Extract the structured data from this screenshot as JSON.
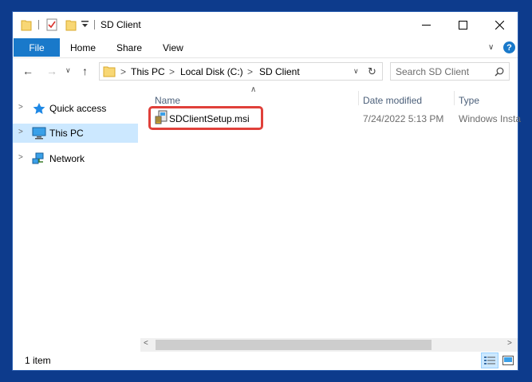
{
  "window": {
    "title": "SD Client"
  },
  "ribbon": {
    "tabs": [
      {
        "label": "File"
      },
      {
        "label": "Home"
      },
      {
        "label": "Share"
      },
      {
        "label": "View"
      }
    ]
  },
  "address": {
    "crumbs": [
      "This PC",
      "Local Disk (C:)",
      "SD Client"
    ]
  },
  "search": {
    "placeholder": "Search SD Client"
  },
  "navpane": {
    "items": [
      {
        "label": "Quick access",
        "icon": "star-icon",
        "selected": false
      },
      {
        "label": "This PC",
        "icon": "computer-icon",
        "selected": true
      },
      {
        "label": "Network",
        "icon": "network-icon",
        "selected": false
      }
    ]
  },
  "content": {
    "columns": [
      "Name",
      "Date modified",
      "Type"
    ],
    "files": [
      {
        "name": "SDClientSetup.msi",
        "date": "7/24/2022 5:13 PM",
        "type": "Windows Insta"
      }
    ]
  },
  "status": {
    "count": "1 item"
  },
  "colors": {
    "accent": "#1979ca",
    "selection": "#cce8ff",
    "highlight": "#e0403a",
    "desktop": "#0d3b8c"
  }
}
